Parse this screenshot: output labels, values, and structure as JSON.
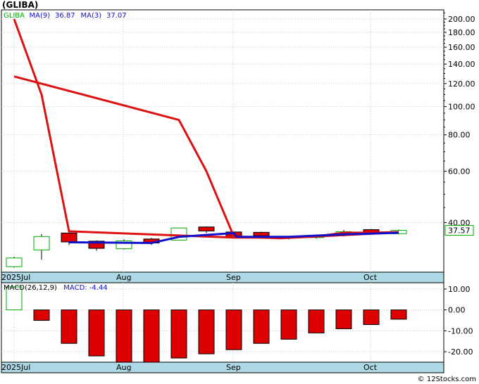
{
  "page_title": "(GLIBA)",
  "credit": "© 12Stocks.com",
  "colors": {
    "up": "#00aa00",
    "down": "#dd0000",
    "ma9": "#1111cc",
    "ma3": "#dd1111",
    "grid": "#c8c8c8",
    "axis_bg": "#add8e6",
    "last_label_border": "#00aa00"
  },
  "chart_data": [
    {
      "type": "candlestick",
      "panel": "price",
      "y_scale": "log",
      "ylim": [
        27,
        215
      ],
      "legend": [
        {
          "label": "GLIBA",
          "color": "#00aa00"
        },
        {
          "label": "MA(9)",
          "color": "#1111cc"
        },
        {
          "label": "36.87",
          "color": "#1111cc"
        },
        {
          "label": "MA(3)",
          "color": "#1111cc"
        },
        {
          "label": "37.07",
          "color": "#1111cc"
        }
      ],
      "y_ticks": [
        "200.00",
        "180.00",
        "160.00",
        "140.00",
        "120.00",
        "100.00",
        "80.00",
        "60.00",
        "40.00"
      ],
      "y_tick_values": [
        200,
        180,
        160,
        140,
        120,
        100,
        80,
        60,
        40
      ],
      "last_price_label": "37.57",
      "last_price_value": 37.57,
      "x_labels": [
        {
          "label": "2025Jul",
          "index": 0
        },
        {
          "label": "Aug",
          "index": 4
        },
        {
          "label": "Sep",
          "index": 8
        },
        {
          "label": "Oct",
          "index": 13
        }
      ],
      "candles": [
        {
          "open": 28.2,
          "high": 30.5,
          "low": 28.0,
          "close": 30.2
        },
        {
          "open": 32.2,
          "high": 36.5,
          "low": 29.8,
          "close": 35.8
        },
        {
          "open": 36.8,
          "high": 37.3,
          "low": 33.5,
          "close": 34.3
        },
        {
          "open": 34.5,
          "high": 34.7,
          "low": 32.0,
          "close": 32.6
        },
        {
          "open": 32.5,
          "high": 35.0,
          "low": 32.3,
          "close": 34.6
        },
        {
          "open": 35.1,
          "high": 35.4,
          "low": 33.5,
          "close": 34.0
        },
        {
          "open": 34.8,
          "high": 38.4,
          "low": 34.7,
          "close": 38.3
        },
        {
          "open": 38.6,
          "high": 38.8,
          "low": 36.8,
          "close": 37.4
        },
        {
          "open": 37.1,
          "high": 37.2,
          "low": 35.2,
          "close": 35.6
        },
        {
          "open": 37.0,
          "high": 37.2,
          "low": 35.4,
          "close": 36.0
        },
        {
          "open": 35.4,
          "high": 35.8,
          "low": 35.0,
          "close": 35.6
        },
        {
          "open": 35.5,
          "high": 36.0,
          "low": 35.2,
          "close": 35.8
        },
        {
          "open": 36.2,
          "high": 37.7,
          "low": 35.8,
          "close": 37.2
        },
        {
          "open": 37.8,
          "high": 38.0,
          "low": 36.4,
          "close": 36.9
        },
        {
          "open": 36.6,
          "high": 37.8,
          "low": 36.4,
          "close": 37.57
        }
      ],
      "ma3": [
        200,
        110,
        37.3,
        null,
        null,
        null,
        null,
        null,
        35.5,
        null,
        35.5,
        35.8,
        36.9,
        36.9,
        37.07
      ],
      "ma3_x": [
        0,
        1,
        2,
        null,
        null,
        null,
        null,
        null,
        8,
        null,
        10,
        11,
        12,
        13,
        14
      ],
      "ma3_long": [
        {
          "x": 0,
          "y": 127
        },
        {
          "x": 6,
          "y": 90
        },
        {
          "x": 7,
          "y": 60
        },
        {
          "x": 8,
          "y": 35.8
        },
        {
          "x": 9.7,
          "y": 35.3
        },
        {
          "x": 14,
          "y": 37.0
        }
      ],
      "ma9": [
        {
          "x": 2,
          "y": 34.2
        },
        {
          "x": 5,
          "y": 34.0
        },
        {
          "x": 6,
          "y": 35.7
        },
        {
          "x": 8,
          "y": 36.8
        },
        {
          "x": 8.1,
          "y": 35.7
        },
        {
          "x": 10,
          "y": 35.7
        },
        {
          "x": 12,
          "y": 36.4
        },
        {
          "x": 14,
          "y": 36.87
        }
      ]
    },
    {
      "type": "bar",
      "panel": "macd",
      "legend": [
        {
          "label": "MACD(26,12,9)",
          "color": "#000000"
        },
        {
          "label": "MACD:",
          "color": "#1111cc"
        },
        {
          "label": "-4.44",
          "color": "#1111cc"
        }
      ],
      "ylim": [
        -25,
        13
      ],
      "y_ticks": [
        "10.00",
        "0.00",
        "-10.00",
        "-20.00"
      ],
      "y_tick_values": [
        10,
        0,
        -10,
        -20
      ],
      "x_labels": [
        {
          "label": "2025Jul",
          "index": 0
        },
        {
          "label": "Aug",
          "index": 4
        },
        {
          "label": "Sep",
          "index": 8
        },
        {
          "label": "Oct",
          "index": 13
        }
      ],
      "values": [
        11,
        -5,
        -16,
        -22,
        -25,
        -25,
        -23,
        -21,
        -19,
        -16,
        -14,
        -11,
        -9,
        -7,
        -4.44
      ]
    }
  ]
}
